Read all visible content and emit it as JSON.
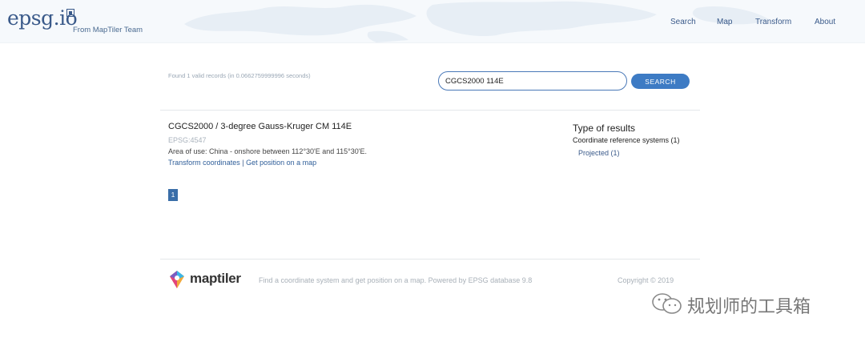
{
  "header": {
    "logo_text": "epsg.io",
    "tagline": "From MapTiler Team",
    "nav": [
      {
        "label": "Search"
      },
      {
        "label": "Map"
      },
      {
        "label": "Transform"
      },
      {
        "label": "About"
      }
    ]
  },
  "search": {
    "status": "Found 1 valid records (in 0.0662759999996 seconds)",
    "value": "CGCS2000 114E",
    "button_label": "SEARCH"
  },
  "results": [
    {
      "title": "CGCS2000 / 3-degree Gauss-Kruger CM 114E",
      "code": "EPSG:4547",
      "area": "Area of use: China - onshore between 112°30'E and 115°30'E.",
      "link_transform": "Transform coordinates",
      "separator": "|",
      "link_map": "Get position on a map"
    }
  ],
  "type_of_results": {
    "title": "Type of results",
    "main": "Coordinate reference systems (1)",
    "sub": "Projected (1)"
  },
  "pagination": {
    "current": "1"
  },
  "footer": {
    "logo_text": "maptiler",
    "description": "Find a coordinate system and get position on a map. Powered by EPSG database 9.8",
    "copyright": "Copyright © 2019"
  },
  "watermark": {
    "text": "规划师的工具箱"
  },
  "colors": {
    "accent": "#3d7bc4",
    "link": "#3a5a8a"
  }
}
